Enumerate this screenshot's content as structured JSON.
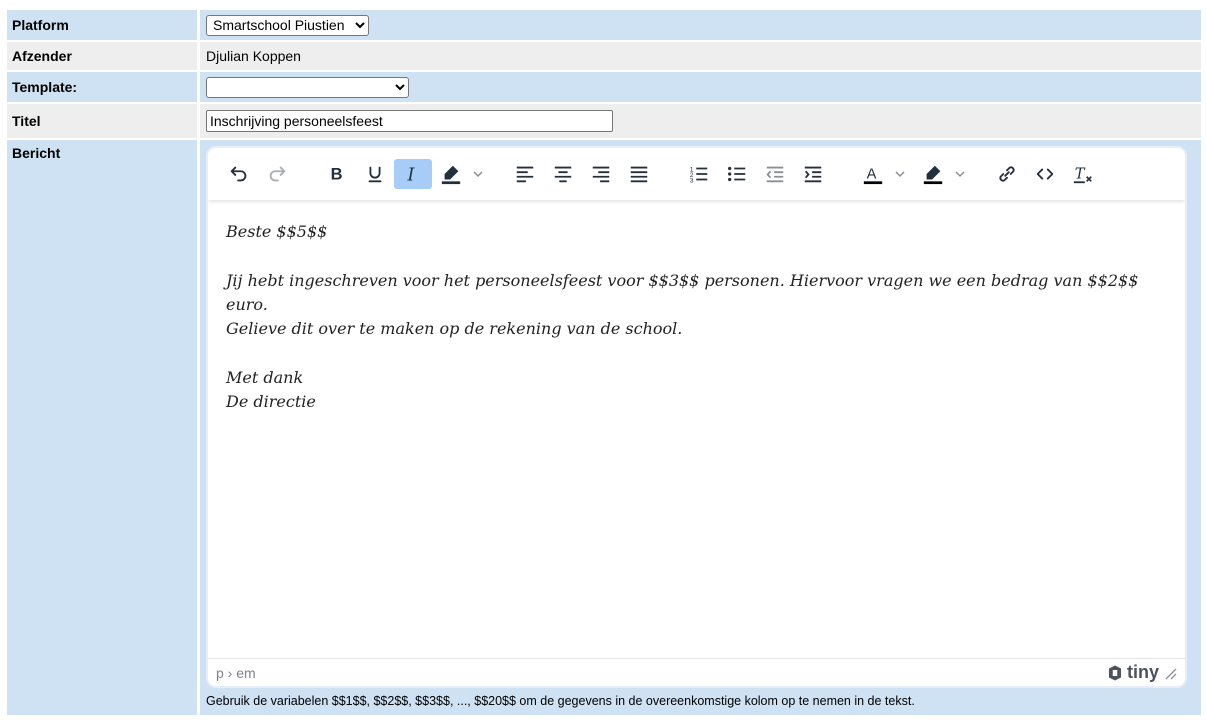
{
  "colors": {
    "label_blue": "#cfe2f3",
    "label_grey": "#eeeeee",
    "active_button": "#a6ccf7"
  },
  "form": {
    "platform": {
      "label": "Platform",
      "selected": "Smartschool Piustien"
    },
    "afzender": {
      "label": "Afzender",
      "value": "Djulian Koppen"
    },
    "template": {
      "label": "Template:",
      "selected": ""
    },
    "titel": {
      "label": "Titel",
      "value": "Inschrijving personeelsfeest"
    },
    "bericht": {
      "label": "Bericht"
    }
  },
  "editor": {
    "toolbar": [
      "undo-icon",
      "redo-icon",
      "bold-icon",
      "underline-icon",
      "italic-icon",
      "highlight-icon",
      "align-left-icon",
      "align-center-icon",
      "align-right-icon",
      "justify-icon",
      "numbered-list-icon",
      "bullet-list-icon",
      "outdent-icon",
      "indent-icon",
      "text-color-icon",
      "background-color-icon",
      "link-icon",
      "code-icon",
      "clear-formatting-icon"
    ],
    "content": {
      "line1": "Beste $$5$$",
      "line2": "Jij hebt ingeschreven voor het personeelsfeest voor $$3$$ personen. Hiervoor vragen we een bedrag van $$2$$ euro.",
      "line3": "Gelieve dit over te maken op de rekening van de school.",
      "line4": "Met dank",
      "line5": "De directie"
    },
    "status_path": "p › em",
    "brand": "tiny"
  },
  "help_text": "Gebruik de variabelen $$1$$, $$2$$, $$3$$, ..., $$20$$ om de gegevens in de overeenkomstige kolom op te nemen in de tekst."
}
